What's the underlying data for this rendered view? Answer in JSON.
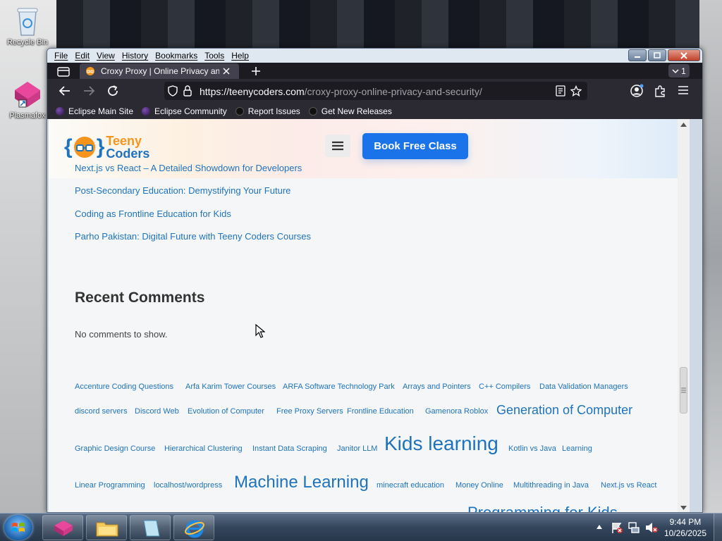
{
  "desktop": {
    "icons": [
      {
        "label": "Recycle Bin"
      },
      {
        "label": "Plasmafox"
      }
    ]
  },
  "browser": {
    "menu": [
      "File",
      "Edit",
      "View",
      "History",
      "Bookmarks",
      "Tools",
      "Help"
    ],
    "tab_title": "Croxy Proxy | Online Privacy anc",
    "tab_count": "1",
    "url_domain": "https://teenycoders.com",
    "url_path": "/croxy-proxy-online-privacy-and-security/",
    "bookmarks": [
      {
        "label": "Eclipse Main Site",
        "color": "#3b1d5a"
      },
      {
        "label": "Eclipse Community",
        "color": "#3b1d5a"
      },
      {
        "label": "Report Issues",
        "color": "#111111"
      },
      {
        "label": "Get New Releases",
        "color": "#111111"
      }
    ]
  },
  "site": {
    "logo_line1": "Teeny",
    "logo_line2": "Coders",
    "cta_label": "Book Free Class",
    "recent_posts": [
      "Next.js vs React – A Detailed Showdown for Developers",
      "Post-Secondary Education: Demystifying Your Future",
      "Coding as Frontline Education for Kids",
      "Parho Pakistan: Digital Future with Teeny Coders Courses"
    ],
    "comments_title": "Recent Comments",
    "no_comments": "No comments to show.",
    "tags": [
      "Accenture Coding Questions",
      "Arfa Karim Tower Courses",
      "ARFA Software Technology Park",
      "Arrays and Pointers",
      "C++ Compilers",
      "Data Validation Managers",
      "discord servers",
      "Discord Web",
      "Evolution of Computer",
      "Free Proxy Servers",
      "Frontline Education",
      "Gamenora Roblox",
      "Generation of Computer",
      "Graphic Design Course",
      "Hierarchical Clustering",
      "Instant Data Scraping",
      "Janitor LLM",
      "Kids learning",
      "Kotlin vs Java",
      "Learning",
      "Linear Programming",
      "localhost/wordpress",
      "Machine Learning",
      "minecraft education",
      "Money Online",
      "Multithreading in Java",
      "Next.js vs React",
      "Programming for Kids"
    ]
  },
  "taskbar": {
    "time": "9:44 PM",
    "date": "10/26/2025"
  },
  "colors": {
    "link": "#1e73be",
    "cta": "#1a73e8",
    "logo_orange": "#f7941d",
    "logo_blue": "#1e73be"
  }
}
